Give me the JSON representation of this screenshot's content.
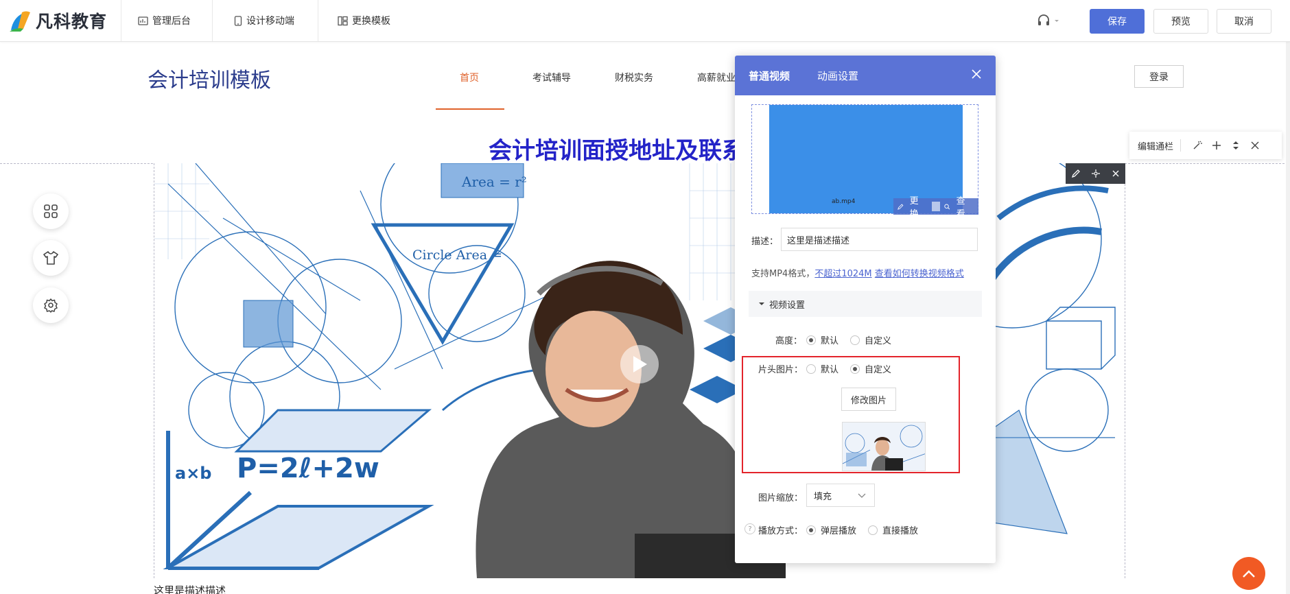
{
  "app": {
    "logo_text": "凡科教育",
    "toolbar": {
      "admin_label": "管理后台",
      "mobile_label": "设计移动端",
      "template_label": "更换模板",
      "save_label": "保存",
      "preview_label": "预览",
      "cancel_label": "取消"
    }
  },
  "site": {
    "title": "会计培训模板",
    "nav": [
      "首页",
      "考试辅导",
      "财税实务",
      "高薪就业"
    ],
    "login_label": "登录",
    "headline": "会计培训面授地址及联系方式",
    "description_bottom": "这里是描述描述"
  },
  "edit_bar": {
    "label": "编辑通栏"
  },
  "panel": {
    "tabs": [
      "普通视频",
      "动画设置"
    ],
    "preview_caption": "ab.mp4",
    "change_label": "更换",
    "view_label": "查看",
    "desc_label": "描述：",
    "desc_value": "这里是描述描述",
    "support_prefix": "支持MP4格式，",
    "support_limit": "不超过1024M",
    "support_link": "查看如何转换视频格式",
    "video_settings_label": "视频设置",
    "height_label": "高度：",
    "height_options": [
      "默认",
      "自定义"
    ],
    "height_selected": "默认",
    "cover_label": "片头图片：",
    "cover_options": [
      "默认",
      "自定义"
    ],
    "cover_selected": "自定义",
    "modify_image_label": "修改图片",
    "scale_label": "图片缩放：",
    "scale_value": "填充",
    "play_mode_label": "播放方式：",
    "play_options": [
      "弹层播放",
      "直接播放"
    ],
    "play_selected": "弹层播放",
    "help_glyph": "?"
  },
  "image_text": {
    "area_formula": "Area = r²",
    "circle_area": "Circle Area =",
    "perimeter": "P=2ℓ+2w",
    "axb": "a×b"
  },
  "colors": {
    "primary": "#4f6fd8",
    "panel_header": "#5b73d6",
    "accent_orange": "#e0622b",
    "headline": "#2323c8",
    "highlight_red": "#e3242b",
    "preview_blue": "#3b8fe8"
  }
}
